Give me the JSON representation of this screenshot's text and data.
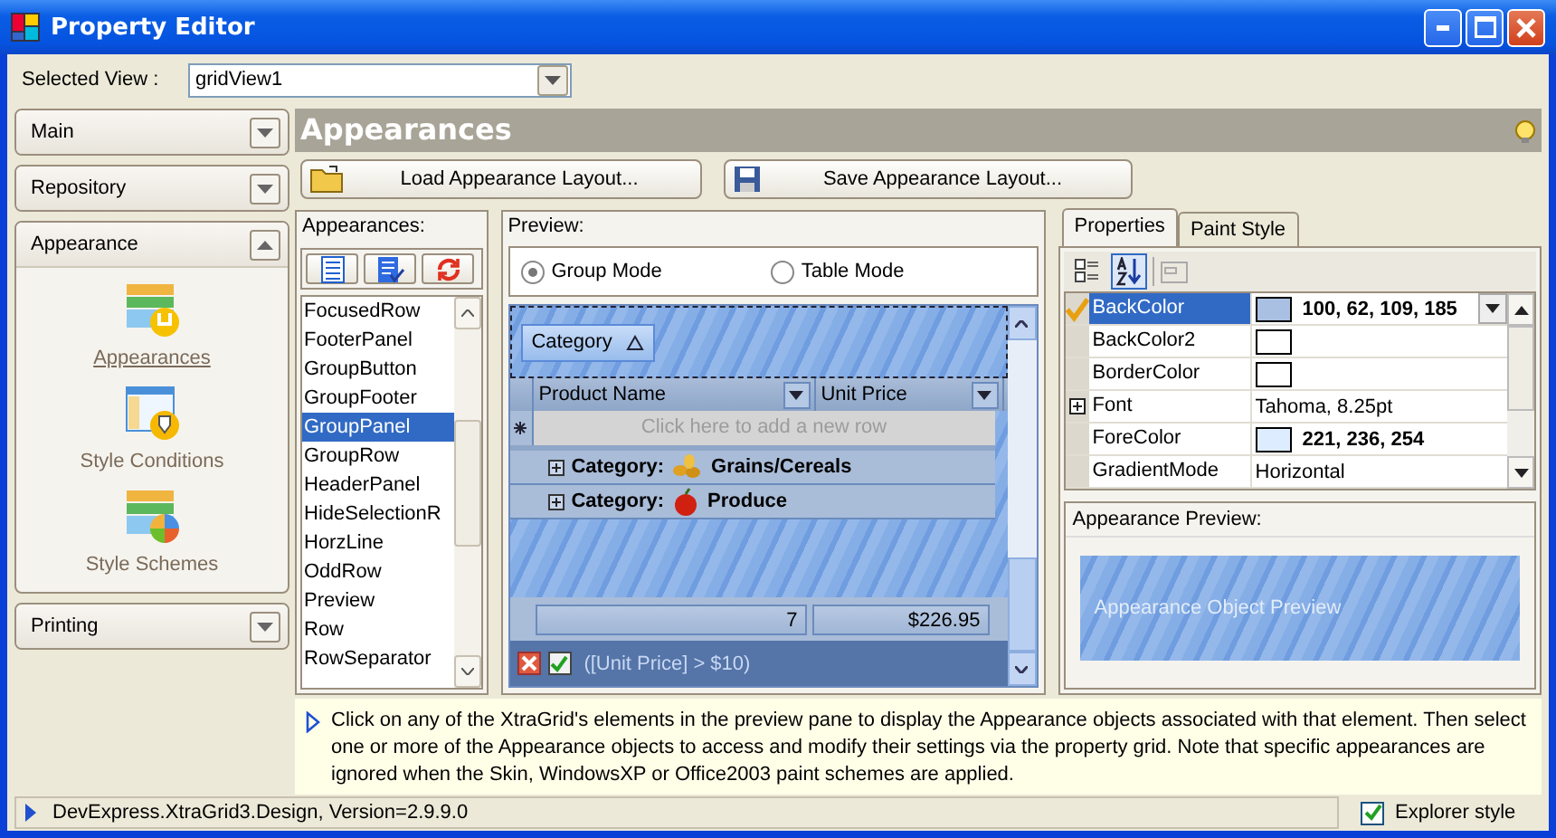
{
  "window": {
    "title": "Property Editor"
  },
  "selected_view": {
    "label": "Selected View :",
    "value": "gridView1"
  },
  "sidebar": {
    "groups": [
      {
        "title": "Main",
        "expanded": false
      },
      {
        "title": "Repository",
        "expanded": false
      },
      {
        "title": "Appearance",
        "expanded": true,
        "items": [
          {
            "label": "Appearances",
            "kind": "appearances",
            "selected": true
          },
          {
            "label": "Style Conditions",
            "kind": "conditions",
            "selected": false
          },
          {
            "label": "Style Schemes",
            "kind": "schemes",
            "selected": false
          }
        ]
      },
      {
        "title": "Printing",
        "expanded": false
      }
    ]
  },
  "header": "Appearances",
  "buttons": [
    {
      "label": "Load Appearance Layout...",
      "kind": "load"
    },
    {
      "label": "Save Appearance Layout...",
      "kind": "save"
    }
  ],
  "appearances": {
    "title": "Appearances:",
    "items": [
      {
        "label": "FocusedRow",
        "selected": false
      },
      {
        "label": "FooterPanel",
        "selected": false
      },
      {
        "label": "GroupButton",
        "selected": false
      },
      {
        "label": "GroupFooter",
        "selected": false
      },
      {
        "label": "GroupPanel",
        "selected": true
      },
      {
        "label": "GroupRow",
        "selected": false
      },
      {
        "label": "HeaderPanel",
        "selected": false
      },
      {
        "label": "HideSelectionR",
        "selected": false
      },
      {
        "label": "HorzLine",
        "selected": false
      },
      {
        "label": "OddRow",
        "selected": false
      },
      {
        "label": "Preview",
        "selected": false
      },
      {
        "label": "Row",
        "selected": false
      },
      {
        "label": "RowSeparator",
        "selected": false
      }
    ]
  },
  "preview": {
    "title": "Preview:",
    "modes": [
      {
        "label": "Group Mode",
        "selected": true
      },
      {
        "label": "Table Mode",
        "selected": false
      }
    ],
    "group_panel": "Category",
    "columns": [
      "Product Name",
      "Unit Price"
    ],
    "new_row": "Click here to add a new row",
    "groups": [
      {
        "label": "Category:",
        "value": "Grains/Cereals",
        "kind": "grain"
      },
      {
        "label": "Category:",
        "value": "Produce",
        "kind": "apple"
      }
    ],
    "footer": [
      "7",
      "$226.95"
    ],
    "filter": {
      "text": "([Unit Price] > $10)",
      "enabled": true
    }
  },
  "properties": {
    "tabs": [
      {
        "label": "Properties",
        "selected": true
      },
      {
        "label": "Paint Style",
        "selected": false
      }
    ],
    "rows": [
      {
        "name": "BackColor",
        "value": "100, 62, 109, 185",
        "color": "#a9c0e2",
        "selected": true,
        "expandable": false
      },
      {
        "name": "BackColor2",
        "color": "#ffffff",
        "selected": false,
        "expandable": false
      },
      {
        "name": "BorderColor",
        "color": "#ffffff",
        "selected": false,
        "expandable": false
      },
      {
        "name": "Font",
        "value": "Tahoma, 8.25pt",
        "selected": false,
        "expandable": true
      },
      {
        "name": "ForeColor",
        "value": "221, 236, 254",
        "color": "#ddecfe",
        "selected": false,
        "expandable": false
      },
      {
        "name": "GradientMode",
        "value": "Horizontal",
        "selected": false,
        "expandable": false
      }
    ]
  },
  "appearance_preview": {
    "title": "Appearance Preview:",
    "text": "Appearance Object Preview"
  },
  "info": "Click on any of the XtraGrid's elements in the preview pane to display the Appearance objects associated with that element. Then select one or more of the Appearance objects to access and modify their settings via the property grid. Note that specific appearances are ignored when the Skin, WindowsXP or Office2003 paint schemes are applied.",
  "status": {
    "text": "DevExpress.XtraGrid3.Design, Version=2.9.9.0",
    "explorer_style": {
      "label": "Explorer style",
      "checked": true
    }
  }
}
